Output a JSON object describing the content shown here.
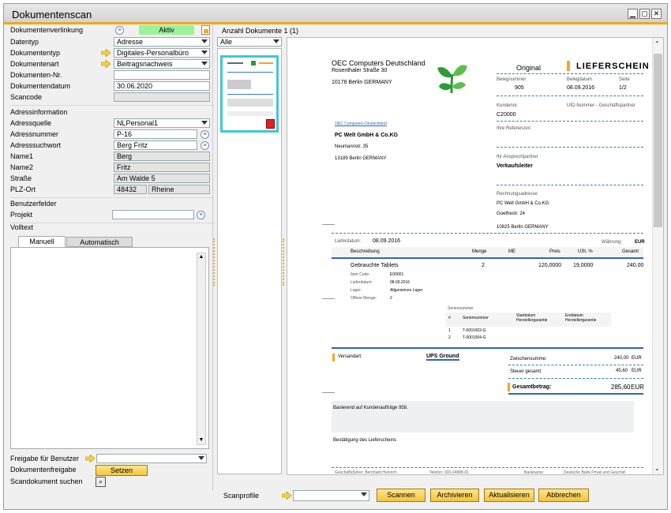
{
  "window": {
    "title": "Dokumentenscan"
  },
  "form": {
    "verlinkung_label": "Dokumentenverlinkung",
    "verlinkung_status": "Aktiv",
    "datentyp_label": "Datentyp",
    "datentyp_value": "Adresse",
    "dokumententyp_label": "Dokumententyp",
    "dokumententyp_value": "Digitales-Personalbüro",
    "dokumentenart_label": "Dokumentenart",
    "dokumentenart_value": "Beitragsnachweis",
    "nr_label": "Dokumenten-Nr.",
    "nr_value": "",
    "datum_label": "Dokumentendatum",
    "datum_value": "30.06.2020",
    "scancode_label": "Scancode",
    "scancode_value": "",
    "adressinfo_header": "Adressinformation",
    "adressquelle_label": "Adressquelle",
    "adressquelle_value": "NLPersonal1",
    "adressnummer_label": "Adressnummer",
    "adressnummer_value": "P-16",
    "adresssuchwort_label": "Adresssuchwort",
    "adresssuchwort_value": "Berg Fritz",
    "name1_label": "Name1",
    "name1_value": "Berg",
    "name2_label": "Name2",
    "name2_value": "Fritz",
    "strasse_label": "Straße",
    "strasse_value": "Am Walde 5",
    "plz_label": "PLZ-Ort",
    "plz_value": "48432",
    "ort_value": "Rheine",
    "benutzerfelder_header": "Benutzerfelder",
    "projekt_label": "Projekt",
    "projekt_value": "",
    "volltext_header": "Volltext",
    "tab_manuell": "Manuell",
    "tab_automatisch": "Automatisch",
    "freigabe_label": "Freigabe für Benutzer",
    "freigabe_value": "",
    "dokfreigabe_label": "Dokumentenfreigabe",
    "setzen_button": "Setzen",
    "suchen_label": "Scandokument suchen"
  },
  "middle": {
    "anzahl": "Anzahl Dokumente 1 (1)",
    "filter_value": "Alle"
  },
  "bottom": {
    "scanprofile_label": "Scanprofile",
    "scanprofile_value": "",
    "scannen": "Scannen",
    "archivieren": "Archivieren",
    "aktualisieren": "Aktualisieren",
    "abbrechen": "Abbrechen"
  },
  "document": {
    "company": "OEC Computers Deutschland",
    "street": "Rosenthaler Straße 30",
    "city": "10178 Berlin GERMANY",
    "original": "Original",
    "doctype": "LIEFERSCHEIN",
    "belegnummer_lbl": "Belegnummer",
    "belegdatum_lbl": "Belegdatum",
    "seite_lbl": "Seite",
    "belegnummer": "905",
    "belegdatum": "08.09.2016",
    "seite": "1/2",
    "kundennr_lbl": "Kundennr.",
    "uid_lbl": "UID-Nummer - Geschäftspartner",
    "kundennr": "C20000",
    "ihre_ref": "Ihre Referenzen",
    "sender_line": "OEC Computers Deutschland",
    "recipient": "PC Welt GmbH & Co.KG",
    "recipient_street": "Neumannstr. 35",
    "recipient_city": "13189 Berlin GERMANY",
    "ansprech_lbl": "Ihr Ansprechpartner",
    "ansprech": "Verkaufsleiter",
    "rechnung_lbl": "Rechnungsadresse",
    "rechnung1": "PC Welt GmbH & Co.KG",
    "rechnung2": "Goethestr. 24",
    "rechnung3": "10825 Berlin GERMANY",
    "lieferdatum_lbl": "Lieferdatum:",
    "lieferdatum": "08.09.2016",
    "waehrung_lbl": "Währung:",
    "waehrung": "EUR",
    "col_beschreibung": "Beschreibung",
    "col_menge": "Menge",
    "col_me": "ME",
    "col_preis": "Preis",
    "col_ust": "USt. %",
    "col_gesamt": "Gesamt",
    "item_name": "Gebrauchte Tablets",
    "item_menge": "2",
    "item_preis": "120,0000",
    "item_ust": "19,0000",
    "item_gesamt": "240,00",
    "item_code_lbl": "Item Code:",
    "item_code": "E00001",
    "item_lief_lbl": "Lieferdatum:",
    "item_lief": "08.09.2016",
    "item_lager_lbl": "Lager:",
    "item_lager": "Allgemeines Lager",
    "item_offen_lbl": "Offene Menge:",
    "item_offen": "2",
    "serien_lbl": "Seriennummer",
    "serien_col1": "#",
    "serien_col2": "Seriennummer",
    "serien_col3": "Startdatum Herstellergarantie",
    "serien_col4": "Enddatum Herstellergarantie",
    "serien_r1_n": "1",
    "serien_r1_s": "T-0001003-G",
    "serien_r2_n": "2",
    "serien_r2_s": "T-0001004-G",
    "versandart_lbl": "Versandart:",
    "versandart": "UPS Ground",
    "zwischen_lbl": "Zwischensumme:",
    "zwischen": "240,00",
    "zwischen_cur": "EUR",
    "steuer_lbl": "Steuer gesamt:",
    "steuer": "45,60",
    "steuer_cur": "EUR",
    "gesamt_lbl": "Gesamtbetrag:",
    "gesamt": "285,60",
    "gesamt_cur": "EUR",
    "basierend": "Basierend auf Kundenaufträge 958.",
    "bestaetigung": "Bestätigung des Lieferscheins",
    "footer1": "Geschäftsführer: Bernhard Heinrich",
    "footer2": "Telefon: 030-24888-01",
    "footer3": "Bankname:",
    "footer4": "Deutsche Bank Privat und Geschäf"
  },
  "colors": {
    "accent": "#f0a81c",
    "status_green": "#9bf29b",
    "doc_blue": "#2e66b5",
    "logo_green": "#2e9a3a"
  }
}
